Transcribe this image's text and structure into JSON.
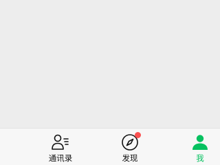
{
  "tabbar": {
    "tabs": [
      {
        "label": "通讯录",
        "icon": "contacts-icon",
        "active": false
      },
      {
        "label": "发现",
        "icon": "compass-icon",
        "active": false,
        "badge": "red-dot"
      },
      {
        "label": "我",
        "icon": "person-icon",
        "active": true
      }
    ]
  },
  "colors": {
    "background": "#ededed",
    "tabbar_background": "#f7f7f7",
    "active": "#07c160",
    "inactive": "#111111",
    "badge": "#fa5151"
  }
}
